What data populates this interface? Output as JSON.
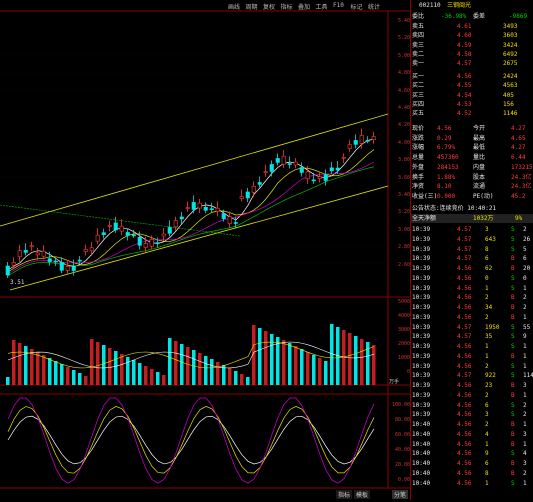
{
  "toolbar": {
    "items": [
      "画线",
      "周期",
      "复权",
      "指标",
      "叠加",
      "工具",
      "F10",
      "标记",
      "统计"
    ]
  },
  "stock": {
    "code": "002110",
    "name": "三钢闽光"
  },
  "price_axis": [
    "5.40",
    "5.20",
    "5.00",
    "4.80",
    "4.60",
    "4.40",
    "4.20",
    "4.00",
    "3.80",
    "3.60",
    "3.40",
    "3.20",
    "3.00",
    "2.80",
    "2.60"
  ],
  "low_label": "3.51",
  "volume_axis": [
    "5000",
    "4000",
    "3000",
    "2000",
    "1000",
    "0"
  ],
  "volume_unit": "万手",
  "kdj_axis": [
    "100.00",
    "80.00",
    "60.00",
    "40.00",
    "20.00",
    "0.00"
  ],
  "header_row": {
    "label": "委比",
    "value": "-36.98%",
    "label2": "委差",
    "value2": "-9869"
  },
  "sell_orders": [
    {
      "label": "卖五",
      "price": "4.61",
      "vol": "3493"
    },
    {
      "label": "卖四",
      "price": "4.60",
      "vol": "3603"
    },
    {
      "label": "卖三",
      "price": "4.59",
      "vol": "3424"
    },
    {
      "label": "卖二",
      "price": "4.58",
      "vol": "6492"
    },
    {
      "label": "卖一",
      "price": "4.57",
      "vol": "2675"
    }
  ],
  "buy_orders": [
    {
      "label": "买一",
      "price": "4.56",
      "vol": "2424"
    },
    {
      "label": "买二",
      "price": "4.55",
      "vol": "4563"
    },
    {
      "label": "买三",
      "price": "4.54",
      "vol": "405"
    },
    {
      "label": "买四",
      "price": "4.53",
      "vol": "156"
    },
    {
      "label": "买五",
      "price": "4.52",
      "vol": "1146"
    }
  ],
  "stats": [
    {
      "l1": "现价",
      "v1": "4.56",
      "l2": "今开",
      "v2": "4.27"
    },
    {
      "l1": "涨跌",
      "v1": "0.29",
      "l2": "最高",
      "v2": "4.65"
    },
    {
      "l1": "涨幅",
      "v1": "6.79%",
      "l2": "最低",
      "v2": "4.27"
    },
    {
      "l1": "总量",
      "v1": "457360",
      "l2": "量比",
      "v2": "6.44"
    },
    {
      "l1": "外盘",
      "v1": "284153",
      "l2": "内盘",
      "v2": "173215"
    },
    {
      "l1": "换手",
      "v1": "1.88%",
      "l2": "股本",
      "v2": "24.3亿"
    },
    {
      "l1": "净资",
      "v1": "8.10",
      "l2": "流通",
      "v2": "24.3亿"
    },
    {
      "l1": "收益(三)",
      "v1": "0.000",
      "l2": "PE(动)",
      "v2": "45.2"
    }
  ],
  "notice": "公告状态:连续竞价 10:40:21",
  "market_row": {
    "label": "全天净额",
    "v1": "1032万",
    "v2": "9%"
  },
  "ticks": [
    {
      "time": "10:39",
      "price": "4.57",
      "vol": "3",
      "flag": "S",
      "n": "2"
    },
    {
      "time": "10:39",
      "price": "4.57",
      "vol": "643",
      "flag": "S",
      "n": "26"
    },
    {
      "time": "10:39",
      "price": "4.57",
      "vol": "8",
      "flag": "S",
      "n": "5"
    },
    {
      "time": "10:39",
      "price": "4.57",
      "vol": "6",
      "flag": "B",
      "n": "6"
    },
    {
      "time": "10:39",
      "price": "4.56",
      "vol": "62",
      "flag": "B",
      "n": "20"
    },
    {
      "time": "10:39",
      "price": "4.56",
      "vol": "0",
      "flag": "S",
      "n": "0"
    },
    {
      "time": "10:39",
      "price": "4.56",
      "vol": "1",
      "flag": "S",
      "n": "1"
    },
    {
      "time": "10:39",
      "price": "4.56",
      "vol": "2",
      "flag": "B",
      "n": "2"
    },
    {
      "time": "10:39",
      "price": "4.56",
      "vol": "34",
      "flag": "B",
      "n": "2"
    },
    {
      "time": "10:39",
      "price": "4.56",
      "vol": "2",
      "flag": "B",
      "n": "1"
    },
    {
      "time": "10:39",
      "price": "4.57",
      "vol": "1950",
      "flag": "S",
      "n": "55"
    },
    {
      "time": "10:39",
      "price": "4.57",
      "vol": "35",
      "flag": "S",
      "n": "9"
    },
    {
      "time": "10:39",
      "price": "4.56",
      "vol": "1",
      "flag": "S",
      "n": "1"
    },
    {
      "time": "10:39",
      "price": "4.56",
      "vol": "1",
      "flag": "B",
      "n": "1"
    },
    {
      "time": "10:39",
      "price": "4.56",
      "vol": "2",
      "flag": "S",
      "n": "1"
    },
    {
      "time": "10:39",
      "price": "4.57",
      "vol": "922",
      "flag": "S",
      "n": "114"
    },
    {
      "time": "10:39",
      "price": "4.56",
      "vol": "23",
      "flag": "B",
      "n": "3"
    },
    {
      "time": "10:39",
      "price": "4.56",
      "vol": "2",
      "flag": "B",
      "n": "1"
    },
    {
      "time": "10:39",
      "price": "4.56",
      "vol": "6",
      "flag": "S",
      "n": "2"
    },
    {
      "time": "10:39",
      "price": "4.56",
      "vol": "3",
      "flag": "S",
      "n": "2"
    },
    {
      "time": "10:40",
      "price": "4.56",
      "vol": "2",
      "flag": "B",
      "n": "1"
    },
    {
      "time": "10:40",
      "price": "4.56",
      "vol": "4",
      "flag": "B",
      "n": "3"
    },
    {
      "time": "10:40",
      "price": "4.56",
      "vol": "1",
      "flag": "B",
      "n": "1"
    },
    {
      "time": "10:40",
      "price": "4.56",
      "vol": "9",
      "flag": "S",
      "n": "4"
    },
    {
      "time": "10:40",
      "price": "4.56",
      "vol": "6",
      "flag": "B",
      "n": "3"
    },
    {
      "time": "10:40",
      "price": "4.56",
      "vol": "8",
      "flag": "B",
      "n": "2"
    },
    {
      "time": "10:40",
      "price": "4.56",
      "vol": "1",
      "flag": "S",
      "n": "1"
    }
  ],
  "bottom_tabs": [
    "指标",
    "模板",
    "",
    "分笔"
  ],
  "colors": {
    "up": "#ff3b3b",
    "down": "#00e5e5",
    "frame": "#8a0000"
  }
}
